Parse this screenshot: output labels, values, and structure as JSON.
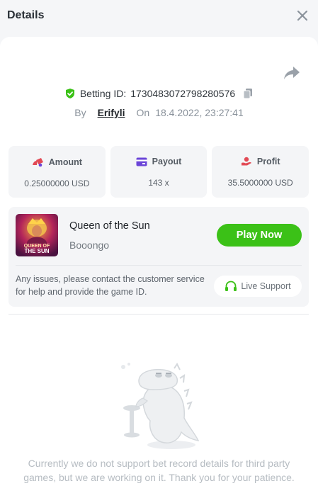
{
  "header": {
    "title": "Details"
  },
  "bet": {
    "id_label": "Betting ID:",
    "id_value": "1730483072798280576",
    "by_label": "By",
    "user": "Erifyli",
    "on_label": "On",
    "datetime": "18.4.2022, 23:27:41"
  },
  "stats": {
    "amount": {
      "label": "Amount",
      "value": "0.25000000 USD"
    },
    "payout": {
      "label": "Payout",
      "value": "143 x"
    },
    "profit": {
      "label": "Profit",
      "value": "35.5000000 USD"
    }
  },
  "game": {
    "name": "Queen of the Sun",
    "provider": "Booongo",
    "thumb_text_1": "QUEEN OF",
    "thumb_text_2": "THE SUN",
    "play_label": "Play Now",
    "issue_text": "Any issues, please contact the customer service for help and provide the game ID.",
    "support_label": "Live Support"
  },
  "notice": "Currently we do not support bet record details for third party games, but we are working on it. Thank you for your patience.",
  "colors": {
    "accent_green": "#3bc117",
    "icon_red": "#e24a55",
    "icon_purple": "#6b45d8"
  },
  "icons": [
    "close-icon",
    "share-icon",
    "shield-check-icon",
    "copy-icon",
    "amount-icon",
    "payout-card-icon",
    "profit-icon",
    "headset-icon",
    "empty-state-dino-illustration"
  ]
}
